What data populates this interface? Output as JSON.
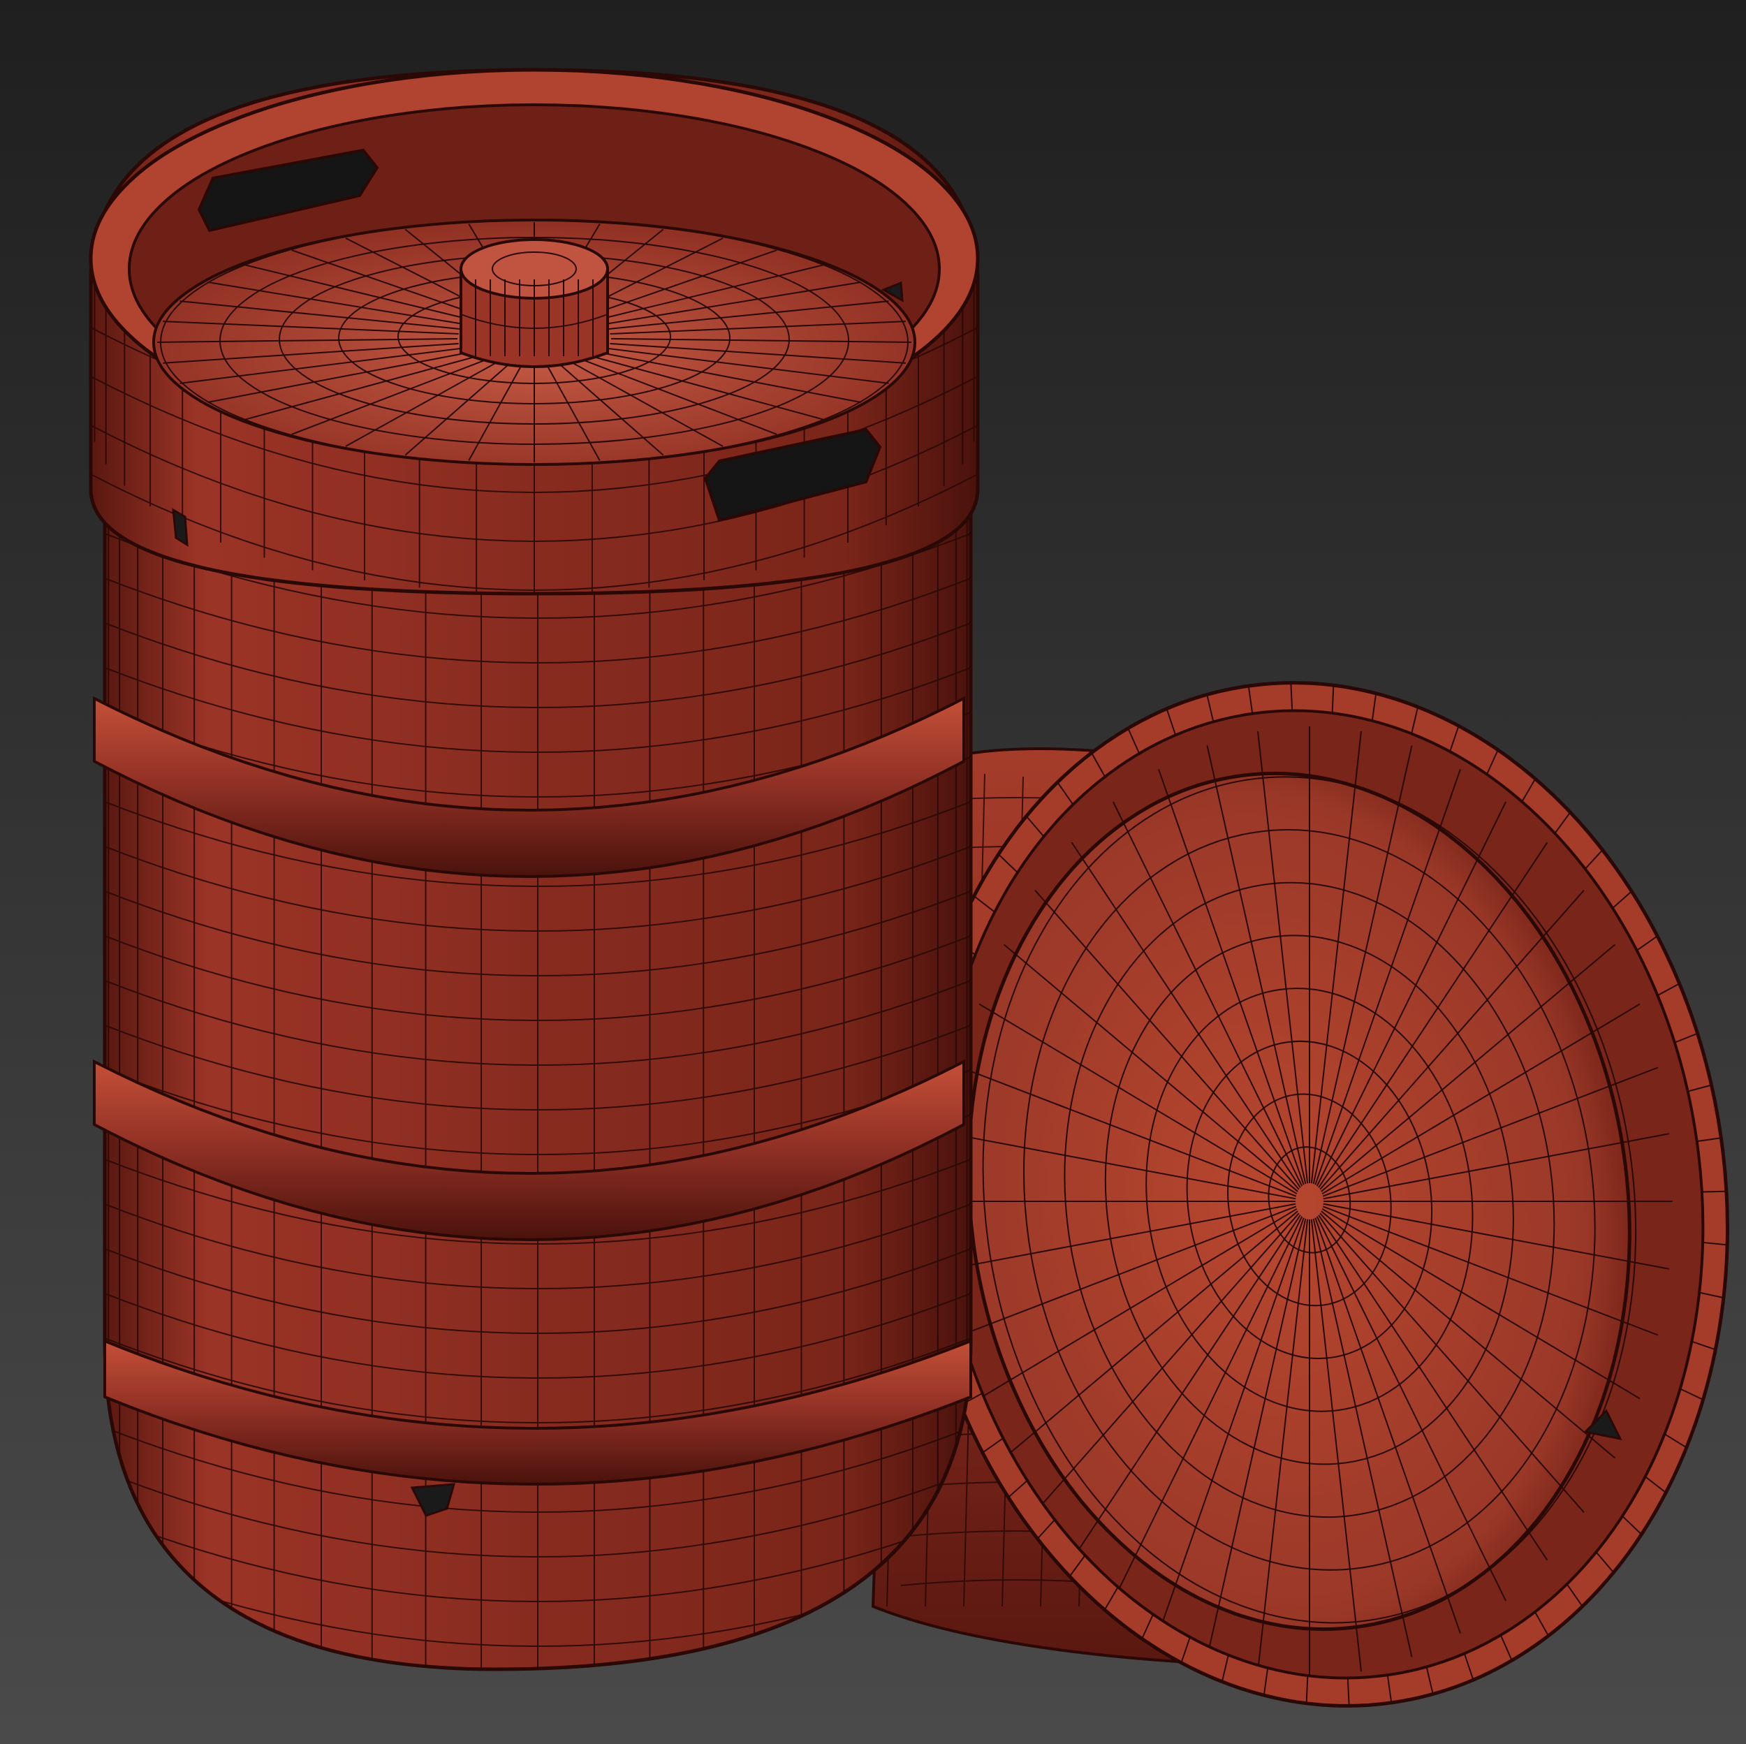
{
  "scene": {
    "subject": "keg-wireframe-render",
    "objects": [
      {
        "name": "upright-keg",
        "orientation": "standing"
      },
      {
        "name": "tipped-keg",
        "orientation": "tilted-on-side"
      }
    ],
    "colors": {
      "background_top": "#1f1f1f",
      "background_bottom": "#4a4a4a",
      "keg_base": "#8e2f24",
      "keg_light": "#c04c38",
      "keg_dark": "#4a120c",
      "wire": "#2a0805"
    }
  }
}
